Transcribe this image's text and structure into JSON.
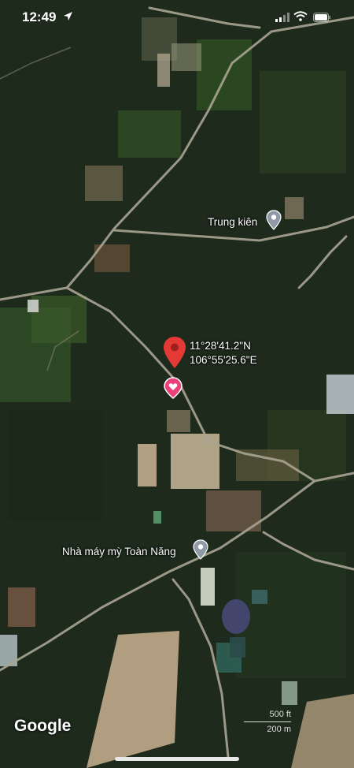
{
  "status_bar": {
    "time": "12:49",
    "icons": [
      "location-arrow-icon",
      "signal-icon",
      "wifi-icon",
      "battery-icon"
    ]
  },
  "map": {
    "selected_pin": {
      "coords_lat": "11°28'41.2\"N",
      "coords_lng": "106°55'25.6\"E",
      "color": "#e53935"
    },
    "places": [
      {
        "name": "Trung kiên",
        "icon": "place-pin-icon"
      },
      {
        "name": "Nhà máy mỳ Toàn Năng",
        "icon": "place-pin-icon"
      }
    ],
    "saved_place_icon": "heart-pin-icon",
    "attribution": "Google",
    "scale": {
      "imperial": "500 ft",
      "metric": "200 m"
    }
  },
  "colors": {
    "road": "#a9a493",
    "vegetation_dark": "#1d2a1c",
    "field_light": "#c8b89a"
  }
}
